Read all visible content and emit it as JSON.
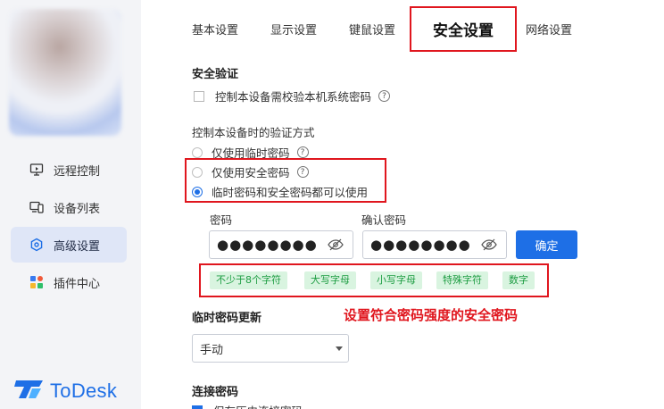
{
  "sidebar": {
    "items": [
      {
        "label": "远程控制",
        "icon": "remote-control-icon"
      },
      {
        "label": "设备列表",
        "icon": "device-list-icon"
      },
      {
        "label": "高级设置",
        "icon": "hexagon-settings-icon",
        "active": true
      },
      {
        "label": "插件中心",
        "icon": "plugin-grid-icon"
      }
    ],
    "brand": "ToDesk"
  },
  "tabs": [
    "基本设置",
    "显示设置",
    "键鼠设置",
    "安全设置",
    "网络设置"
  ],
  "active_tab": "安全设置",
  "security_verification": {
    "title": "安全验证",
    "option_label": "控制本设备需校验本机系统密码",
    "checked": false
  },
  "verify_method": {
    "title": "控制本设备时的验证方式",
    "options": [
      "仅使用临时密码",
      "仅使用安全密码",
      "临时密码和安全密码都可以使用"
    ],
    "selected": "临时密码和安全密码都可以使用"
  },
  "password": {
    "label": "密码",
    "confirm_label": "确认密码",
    "value": "●●●●●●●●",
    "confirm_value": "●●●●●●●●",
    "confirm_button": "确定"
  },
  "requirements": [
    "不少于8个字符",
    "大写字母",
    "小写字母",
    "特殊字符",
    "数字"
  ],
  "annotation": "设置符合密码强度的安全密码",
  "temp_password_update": {
    "title": "临时密码更新",
    "value": "手动"
  },
  "connection_password": {
    "title": "连接密码",
    "option_label": "保存历史连接密码",
    "checked": true
  },
  "colors": {
    "accent": "#1e6fe6",
    "annotation_red": "#e0161e",
    "tag_bg": "#d9f4e0",
    "tag_text": "#1e9d43"
  }
}
